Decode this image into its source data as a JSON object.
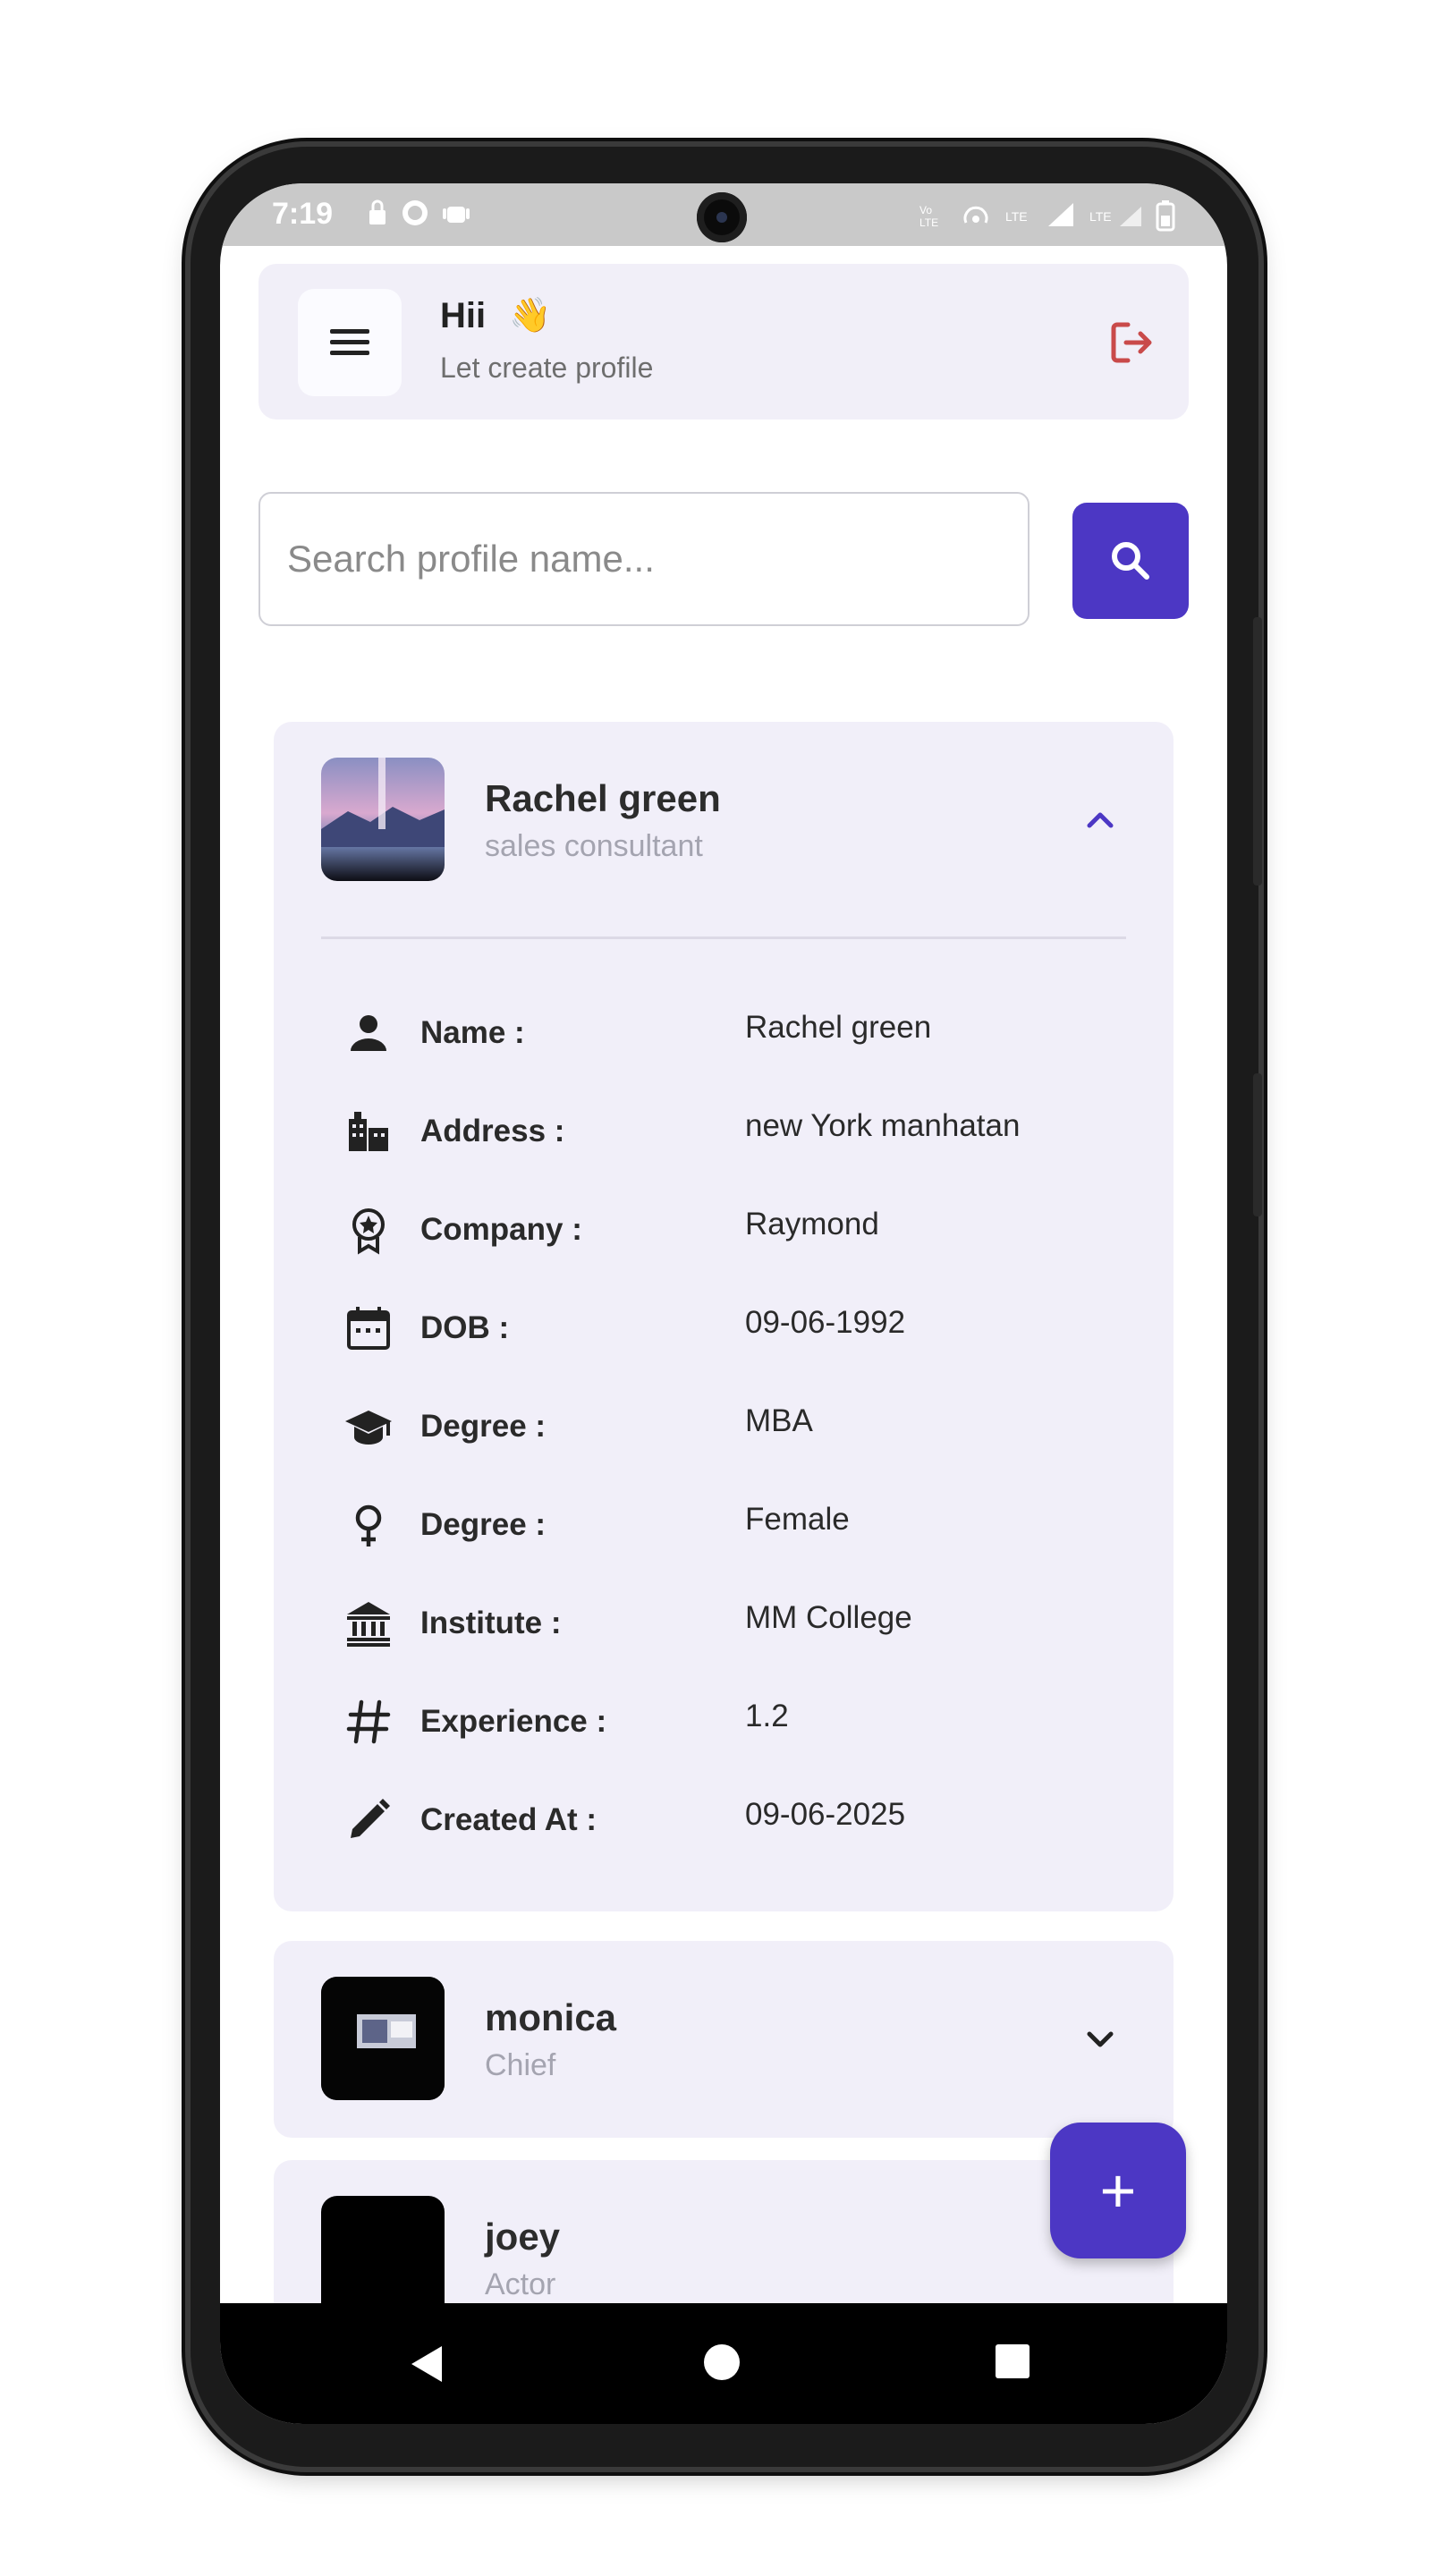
{
  "status_bar": {
    "time": "7:19",
    "left_icons": [
      "lock-icon",
      "whatsapp-icon",
      "android-icon"
    ],
    "right_icons": [
      "volte-icon",
      "hotspot-icon",
      "lte-icon",
      "signal-icon",
      "lte-signal-icon",
      "battery-icon"
    ]
  },
  "header": {
    "greeting": "Hii",
    "emoji": "👋",
    "subtitle": "Let create profile"
  },
  "search": {
    "placeholder": "Search profile name..."
  },
  "colors": {
    "accent": "#4c37c4",
    "card_bg": "#f1eff9",
    "logout": "#c94a4a"
  },
  "profiles": [
    {
      "name": "Rachel green",
      "role": "sales consultant",
      "expanded": true,
      "details": [
        {
          "icon": "person-icon",
          "label": "Name :",
          "value": "Rachel green"
        },
        {
          "icon": "building-icon",
          "label": "Address :",
          "value": "new York manhatan"
        },
        {
          "icon": "award-icon",
          "label": "Company :",
          "value": "Raymond"
        },
        {
          "icon": "calendar-icon",
          "label": "DOB :",
          "value": "09-06-1992"
        },
        {
          "icon": "graduation-cap-icon",
          "label": "Degree :",
          "value": "MBA"
        },
        {
          "icon": "female-icon",
          "label": "Degree :",
          "value": "Female"
        },
        {
          "icon": "institute-icon",
          "label": "Institute :",
          "value": "MM College"
        },
        {
          "icon": "hash-icon",
          "label": "Experience :",
          "value": "1.2"
        },
        {
          "icon": "pencil-icon",
          "label": "Created At :",
          "value": "09-06-2025"
        }
      ]
    },
    {
      "name": "monica",
      "role": "Chief",
      "expanded": false
    },
    {
      "name": "joey",
      "role": "Actor",
      "expanded": false
    }
  ],
  "fab": {
    "label": "+"
  }
}
